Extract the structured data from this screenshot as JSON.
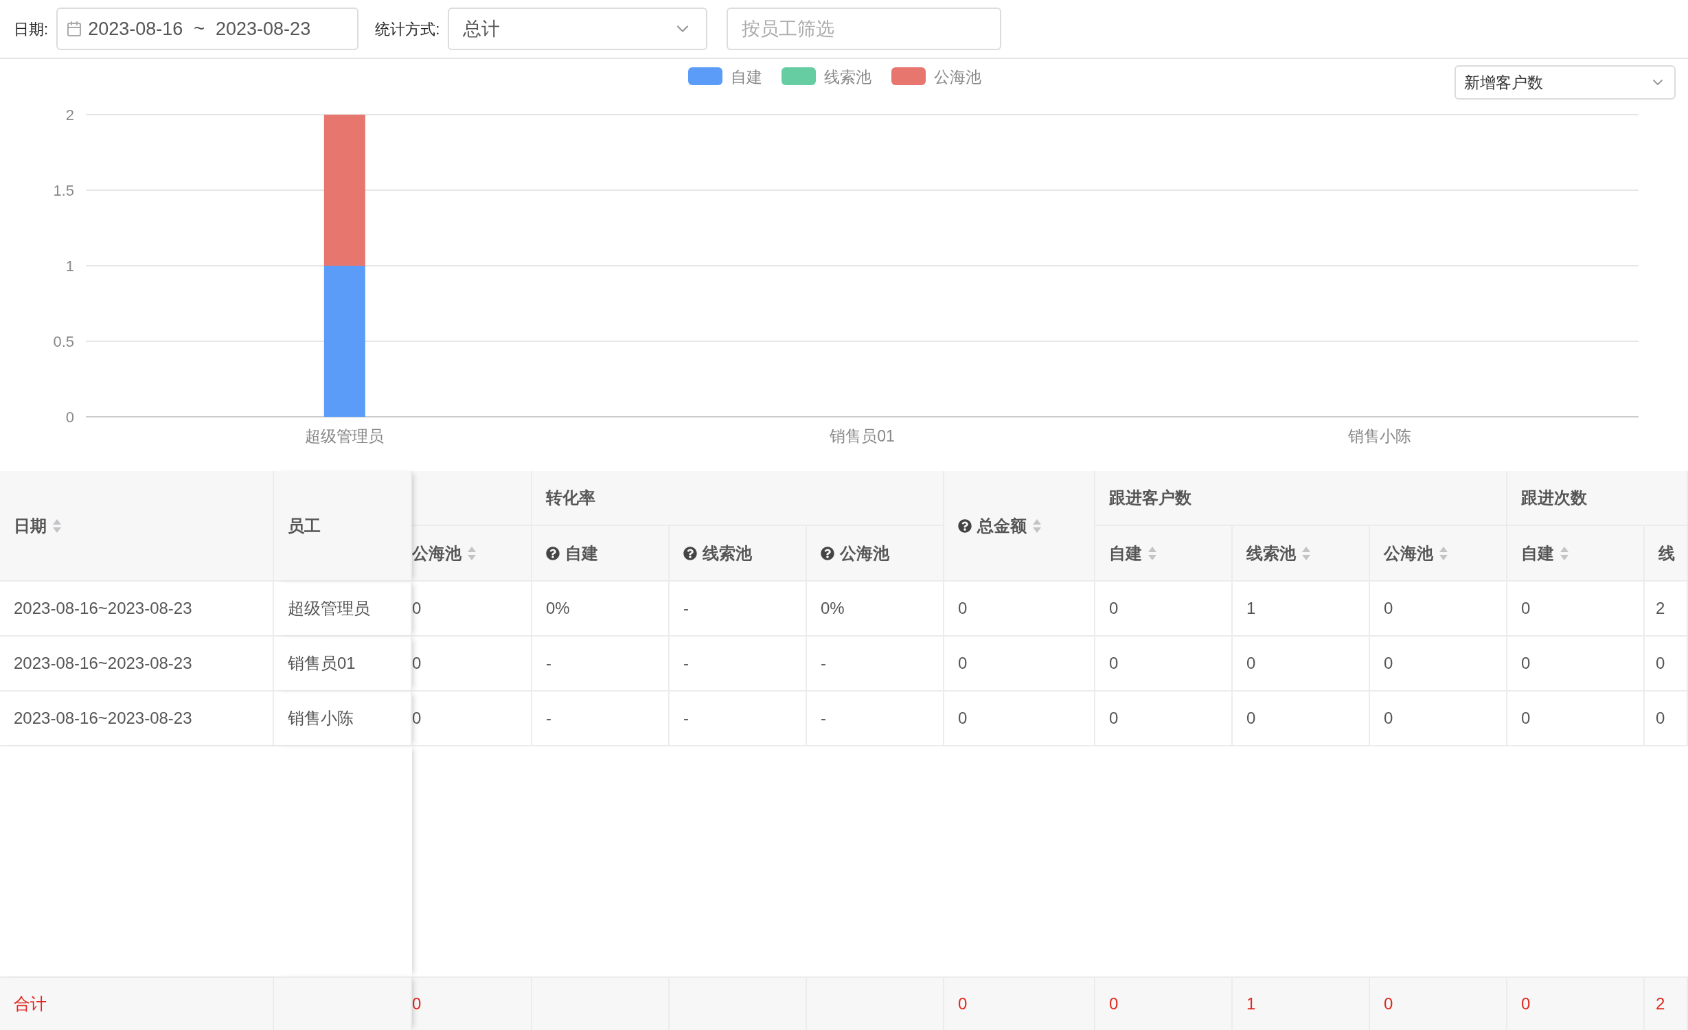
{
  "filters": {
    "date_label": "日期:",
    "date_start": "2023-08-16",
    "date_separator": "~",
    "date_end": "2023-08-23",
    "mode_label": "统计方式:",
    "mode_value": "总计",
    "employee_placeholder": "按员工筛选"
  },
  "chart": {
    "metric_select": "新增客户数",
    "chart_data": {
      "type": "bar",
      "stacked": true,
      "categories": [
        "超级管理员",
        "销售员01",
        "销售小陈"
      ],
      "series": [
        {
          "name": "自建",
          "color": "#5b9cf8",
          "values": [
            1,
            0,
            0
          ]
        },
        {
          "name": "线索池",
          "color": "#66cda3",
          "values": [
            0,
            0,
            0
          ]
        },
        {
          "name": "公海池",
          "color": "#e6766e",
          "values": [
            1,
            0,
            0
          ]
        }
      ],
      "grid": true,
      "legend": true,
      "ylim": [
        0,
        2
      ],
      "yticks": [
        0,
        {
          "value": 0.5,
          "label": "0.5"
        },
        1,
        {
          "value": 1.5,
          "label": "1.5"
        },
        2
      ]
    }
  },
  "table": {
    "fixed_columns": [
      {
        "label": "日期",
        "sortable": true
      },
      {
        "label": "员工"
      }
    ],
    "headers": [
      {
        "kind": "group",
        "columns": [
          {
            "label": "公海池",
            "sortable": true
          }
        ]
      },
      {
        "kind": "group",
        "label": "转化率",
        "columns": [
          {
            "label": "自建",
            "help": true
          },
          {
            "label": "线索池",
            "help": true
          },
          {
            "label": "公海池",
            "help": true
          }
        ]
      },
      {
        "kind": "column",
        "label": "总金额",
        "help": true,
        "sortable": true
      },
      {
        "kind": "group",
        "label": "跟进客户数",
        "columns": [
          {
            "label": "自建",
            "sortable": true
          },
          {
            "label": "线索池",
            "sortable": true
          },
          {
            "label": "公海池",
            "sortable": true
          }
        ]
      },
      {
        "kind": "group",
        "label": "跟进次数",
        "columns": [
          {
            "label": "自建",
            "sortable": true
          },
          {
            "label": "线"
          }
        ]
      }
    ],
    "rows": [
      {
        "kind": "data",
        "cells": [
          "2023-08-16~2023-08-23",
          "超级管理员",
          "0",
          "0%",
          "-",
          "0%",
          "0",
          "0",
          "1",
          "0",
          "0",
          "2"
        ]
      },
      {
        "kind": "data",
        "cells": [
          "2023-08-16~2023-08-23",
          "销售员01",
          "0",
          "-",
          "-",
          "-",
          "0",
          "0",
          "0",
          "0",
          "0",
          "0"
        ]
      },
      {
        "kind": "data",
        "cells": [
          "2023-08-16~2023-08-23",
          "销售小陈",
          "0",
          "-",
          "-",
          "-",
          "0",
          "0",
          "0",
          "0",
          "0",
          "0"
        ]
      },
      {
        "kind": "total",
        "cells": [
          "合计",
          null,
          "0",
          null,
          null,
          null,
          "0",
          "0",
          "1",
          "0",
          "0",
          "2"
        ]
      }
    ]
  }
}
